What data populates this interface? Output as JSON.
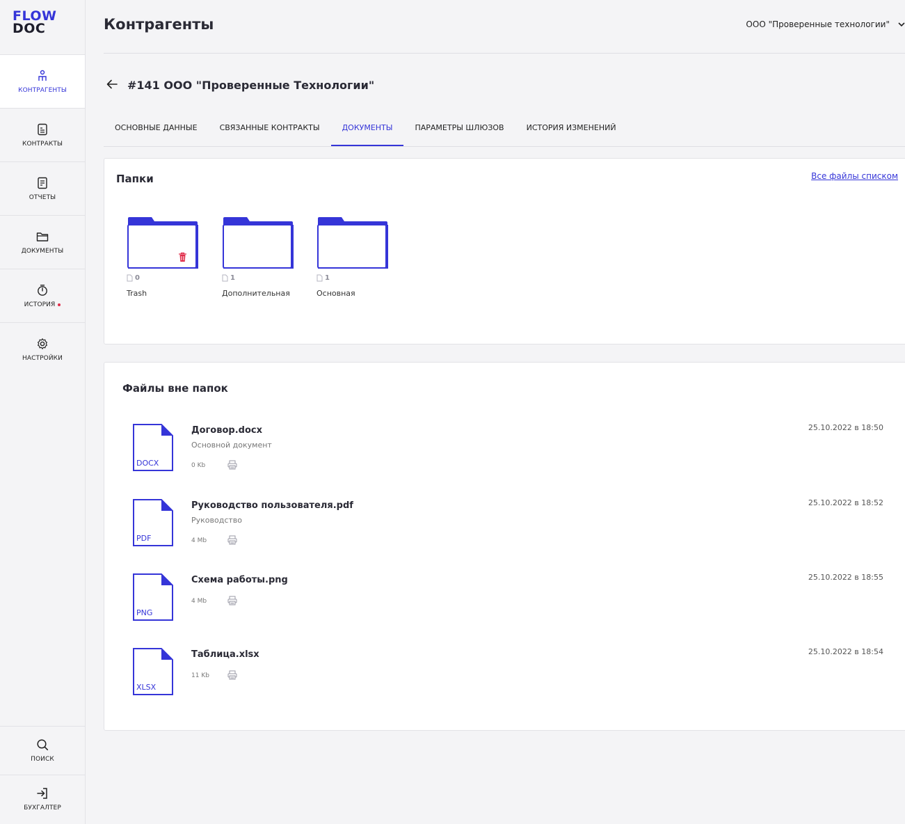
{
  "logo": {
    "line1": "FLOW",
    "line2": "DOC"
  },
  "sidebar": {
    "items": [
      {
        "label": "КОНТРАГЕНТЫ",
        "icon": "people-icon",
        "active": true
      },
      {
        "label": "КОНТРАКТЫ",
        "icon": "contract-icon"
      },
      {
        "label": "ОТЧЕТЫ",
        "icon": "report-icon"
      },
      {
        "label": "ДОКУМЕНТЫ",
        "icon": "folder-icon"
      },
      {
        "label": "ИСТОРИЯ",
        "icon": "stopwatch-icon",
        "badge_color": "#e02d4a"
      },
      {
        "label": "НАСТРОЙКИ",
        "icon": "gear-icon"
      }
    ],
    "bottom": [
      {
        "label": "ПОИСК",
        "icon": "search-icon"
      },
      {
        "label": "БУХГАЛТЕР",
        "icon": "login-icon"
      }
    ]
  },
  "header": {
    "title": "Контрагенты",
    "org": "ООО \"Проверенные технологии\""
  },
  "entity": {
    "title": "#141 ООО \"Проверенные Технологии\""
  },
  "tabs": [
    {
      "label": "ОСНОВНЫЕ ДАННЫЕ"
    },
    {
      "label": "СВЯЗАННЫЕ КОНТРАКТЫ"
    },
    {
      "label": "ДОКУМЕНТЫ",
      "active": true
    },
    {
      "label": "ПАРАМЕТРЫ ШЛЮЗОВ"
    },
    {
      "label": "ИСТОРИЯ ИЗМЕНЕНИЙ"
    }
  ],
  "folders_panel": {
    "title": "Папки",
    "all_files_link": "Все файлы списком",
    "folders": [
      {
        "name": "Trash",
        "count": "0",
        "has_delete": true
      },
      {
        "name": "Дополнительная",
        "count": "1"
      },
      {
        "name": "Основная",
        "count": "1"
      }
    ]
  },
  "files_panel": {
    "title": "Файлы вне папок",
    "files": [
      {
        "ext": "DOCX",
        "name": "Договор.docx",
        "subtitle": "Основной документ",
        "size": "0 Kb",
        "date": "25.10.2022 в 18:50"
      },
      {
        "ext": "PDF",
        "name": "Руководство пользователя.pdf",
        "subtitle": "Руководство",
        "size": "4 Mb",
        "date": "25.10.2022 в 18:52"
      },
      {
        "ext": "PNG",
        "name": "Схема работы.png",
        "subtitle": "",
        "size": "4 Mb",
        "date": "25.10.2022 в 18:55"
      },
      {
        "ext": "XLSX",
        "name": "Таблица.xlsx",
        "subtitle": "",
        "size": "11 Kb",
        "date": "25.10.2022 в 18:54"
      }
    ]
  },
  "colors": {
    "accent": "#3535d8",
    "danger": "#e02d4a"
  }
}
